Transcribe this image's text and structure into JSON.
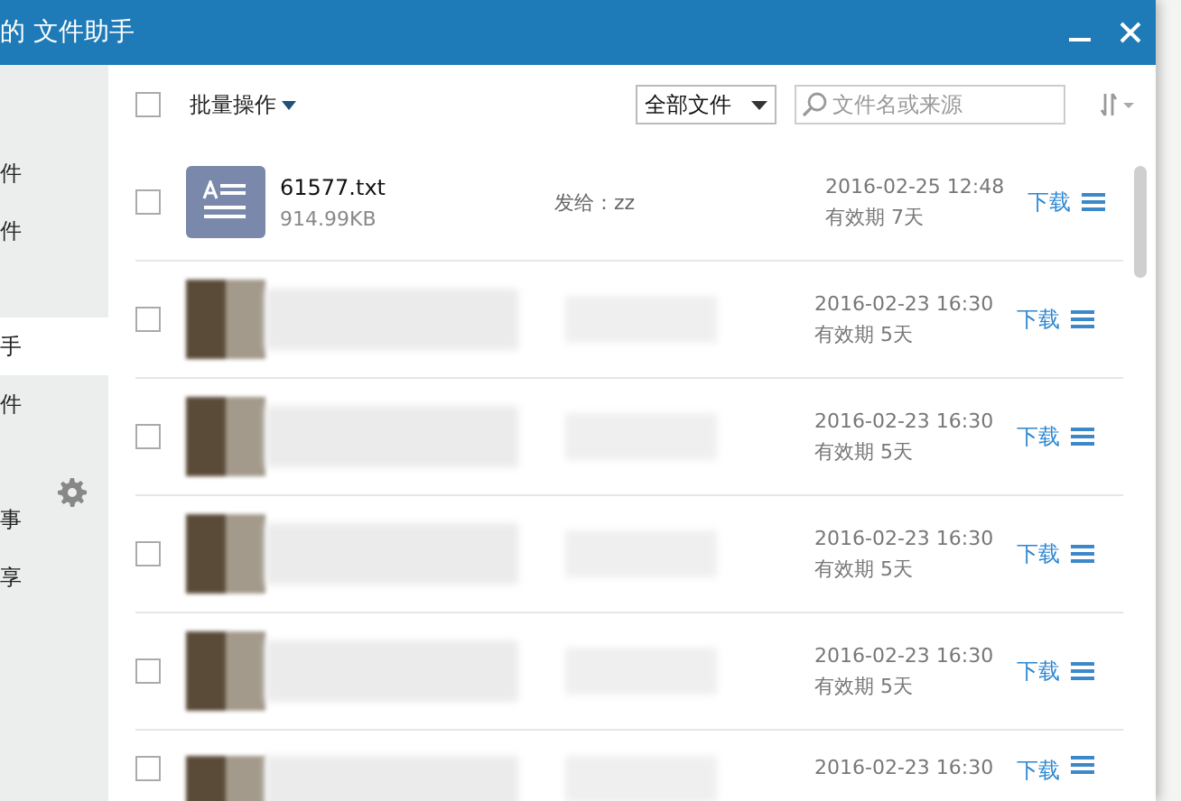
{
  "window": {
    "title": "的 文件助手"
  },
  "sidebar": {
    "items": [
      {
        "label": "件",
        "selected": false
      },
      {
        "label": "件",
        "selected": false
      },
      {
        "label": "手",
        "selected": true
      },
      {
        "label": "件",
        "selected": false
      },
      {
        "label": "事",
        "selected": false
      },
      {
        "label": "享",
        "selected": false
      }
    ]
  },
  "toolbar": {
    "select_all": {
      "checked": false
    },
    "batch_label": "批量操作",
    "filter": "全部文件",
    "search": {
      "placeholder": "文件名或来源"
    }
  },
  "files": [
    {
      "kind": "text",
      "checked": false,
      "name": "61577.txt",
      "size": "914.99KB",
      "recipient": "发给：zz",
      "date": "2016-02-25 12:48",
      "expiry": "有效期 7天",
      "action": "下载"
    },
    {
      "kind": "blurred",
      "checked": false,
      "date": "2016-02-23 16:30",
      "expiry": "有效期 5天",
      "action": "下载"
    },
    {
      "kind": "blurred",
      "checked": false,
      "date": "2016-02-23 16:30",
      "expiry": "有效期 5天",
      "action": "下载"
    },
    {
      "kind": "blurred",
      "checked": false,
      "date": "2016-02-23 16:30",
      "expiry": "有效期 5天",
      "action": "下载"
    },
    {
      "kind": "blurred",
      "checked": false,
      "date": "2016-02-23 16:30",
      "expiry": "有效期 5天",
      "action": "下载"
    },
    {
      "kind": "blurred",
      "checked": false,
      "date": "2016-02-23 16:30",
      "action": "下载"
    }
  ]
}
